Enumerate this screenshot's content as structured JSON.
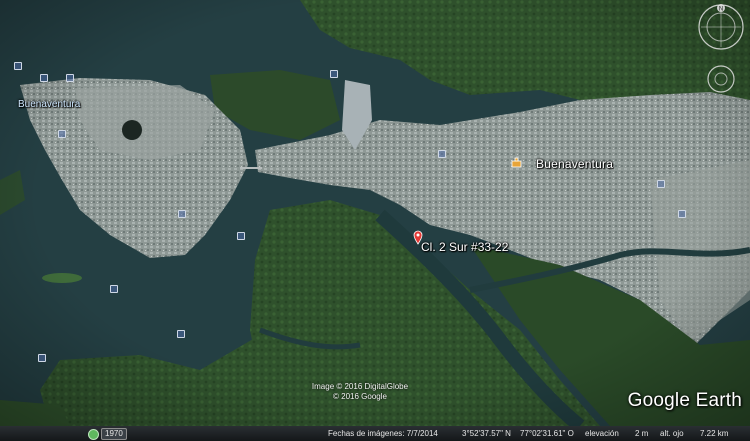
{
  "map": {
    "labels": {
      "city_main": "Buenaventura",
      "city_west": "Buenaventura",
      "address": "Cl. 2 Sur #33-22"
    },
    "attribution": {
      "line1": "Image © 2016 DigitalGlobe",
      "line2": "© 2016 Google"
    },
    "brand": "Google Earth",
    "colors": {
      "water": "#233f42",
      "forest": "#2e4f2b",
      "urban": "#8c9693",
      "pin": "#e53935"
    },
    "icons": [
      "location-pin-icon",
      "city-icon",
      "compass-icon",
      "look-joystick-icon",
      "time-tour-icon"
    ]
  },
  "status_bar": {
    "year": "1970",
    "imagery_date": "Fechas de imágenes: 7/7/2014",
    "lat": "3°52'37.57\" N",
    "lon": "77°02'31.61\" O",
    "elevation": "elevación",
    "elevation_value": "2 m",
    "eye_alt": "alt. ojo",
    "eye_alt_value": "7.22 km"
  },
  "controls": {
    "compass_north": "N"
  }
}
